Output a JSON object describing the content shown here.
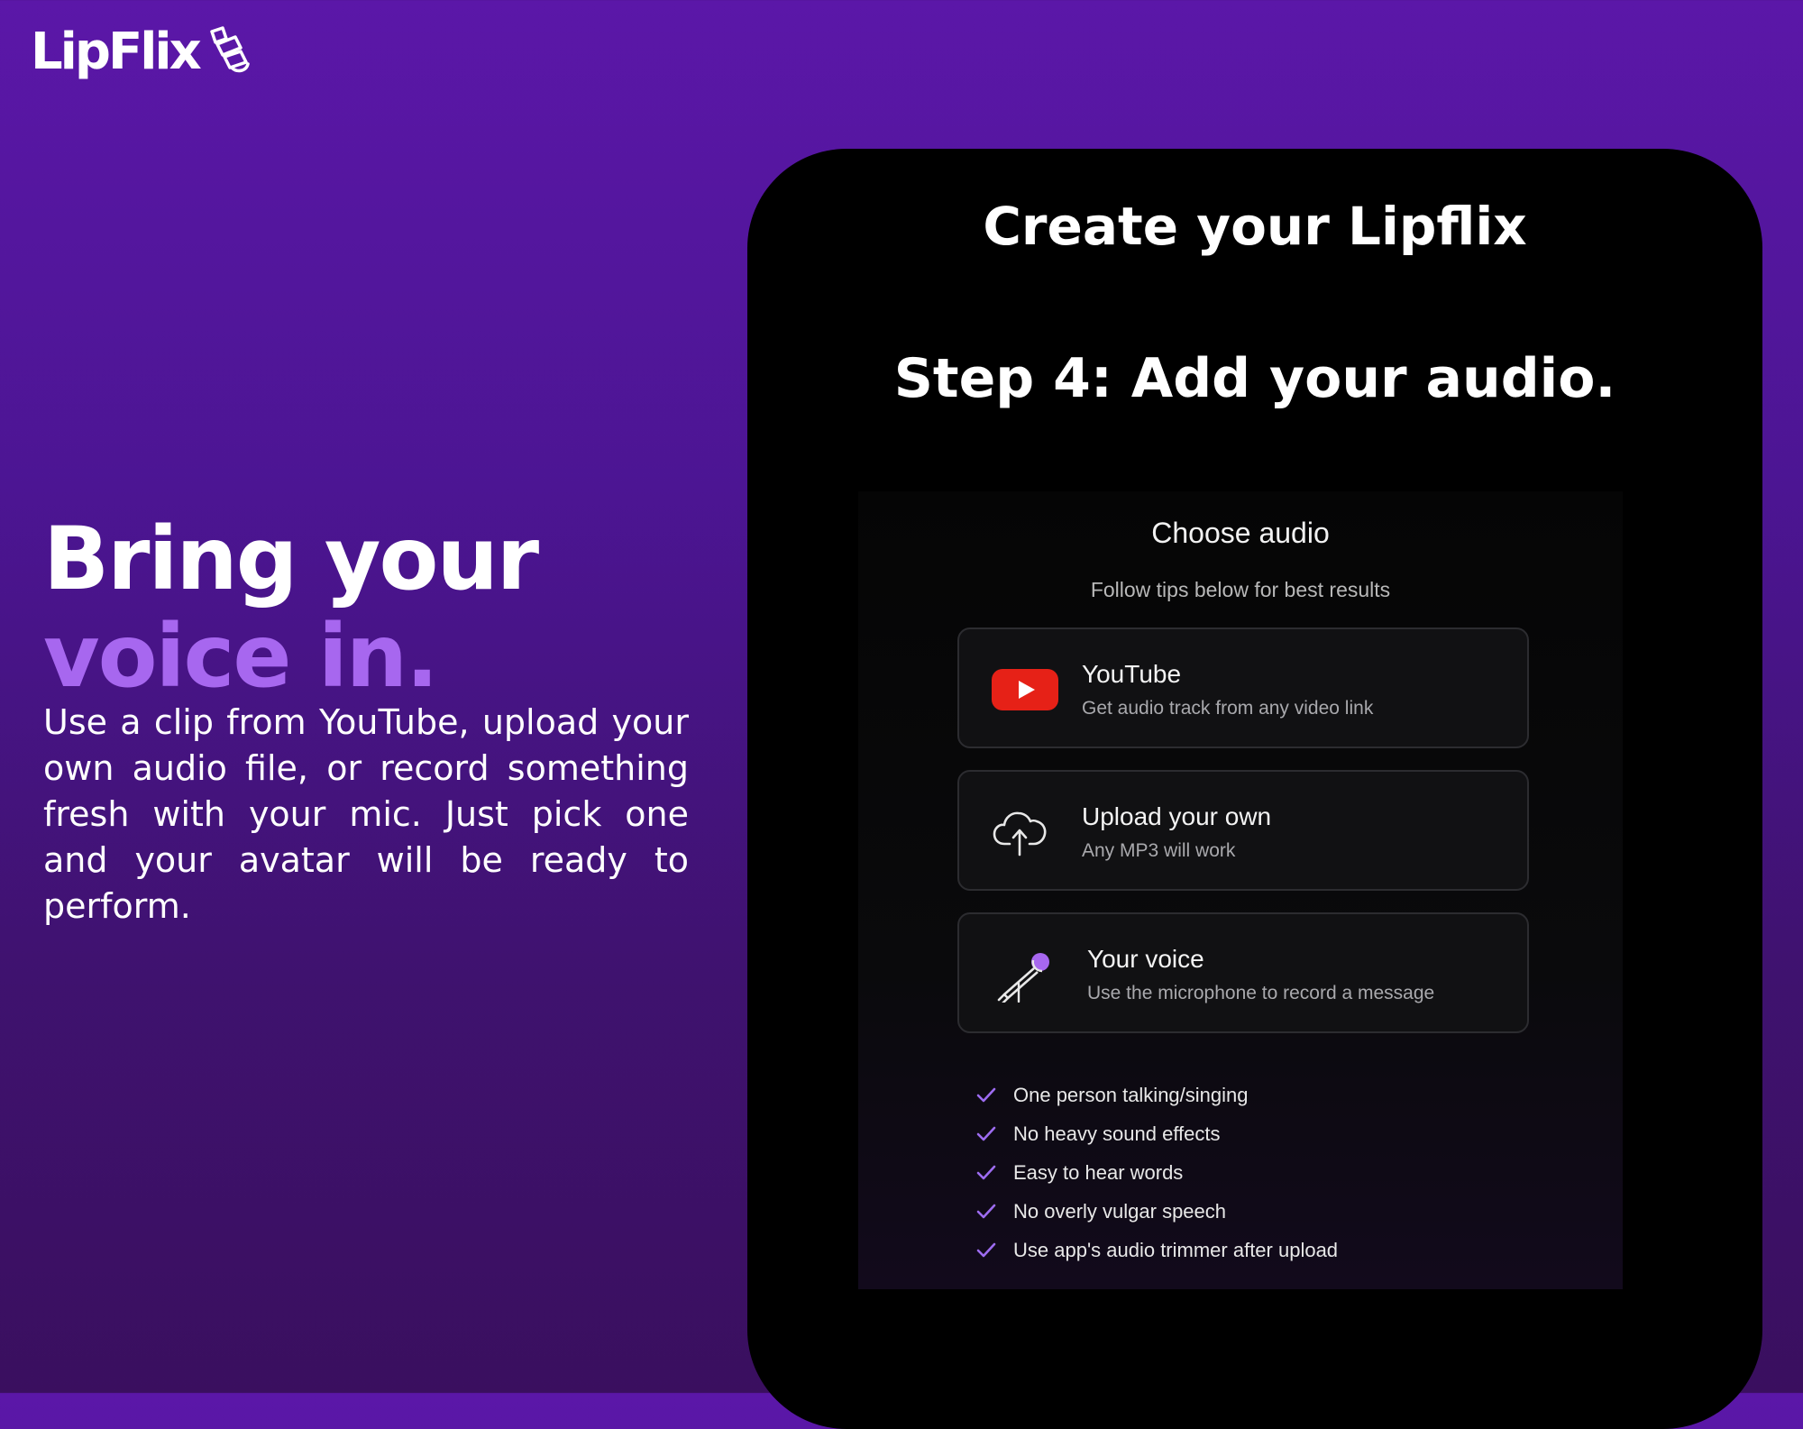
{
  "brand": {
    "logo_text": "LipFlix",
    "logo_icon": "hand-icon"
  },
  "hero": {
    "title_line1": "Bring your",
    "title_line2": "voice in.",
    "body": "Use a clip from YouTube, upload your own audio file, or record something fresh with your mic. Just pick one and your avatar will be ready to perform."
  },
  "panel": {
    "title": "Create your Lipflix",
    "step": "Step 4: Add your audio."
  },
  "app": {
    "heading": "Choose audio",
    "subheading": "Follow tips below for best results",
    "options": [
      {
        "icon": "youtube-icon",
        "title": "YouTube",
        "description": "Get audio track from any video link"
      },
      {
        "icon": "cloud-upload-icon",
        "title": "Upload your own",
        "description": "Any MP3 will work"
      },
      {
        "icon": "microphone-icon",
        "title": "Your voice",
        "description": "Use the microphone to record a message"
      }
    ],
    "tips": [
      "One person talking/singing",
      "No heavy sound effects",
      "Easy to hear words",
      "No overly vulgar speech",
      "Use app's audio trimmer after upload"
    ]
  },
  "colors": {
    "background_top": "#5b17a8",
    "background_bottom": "#3a0f5f",
    "accent_purple": "#a767ef",
    "youtube_red": "#e62117",
    "check_purple": "#9d6cf0"
  }
}
